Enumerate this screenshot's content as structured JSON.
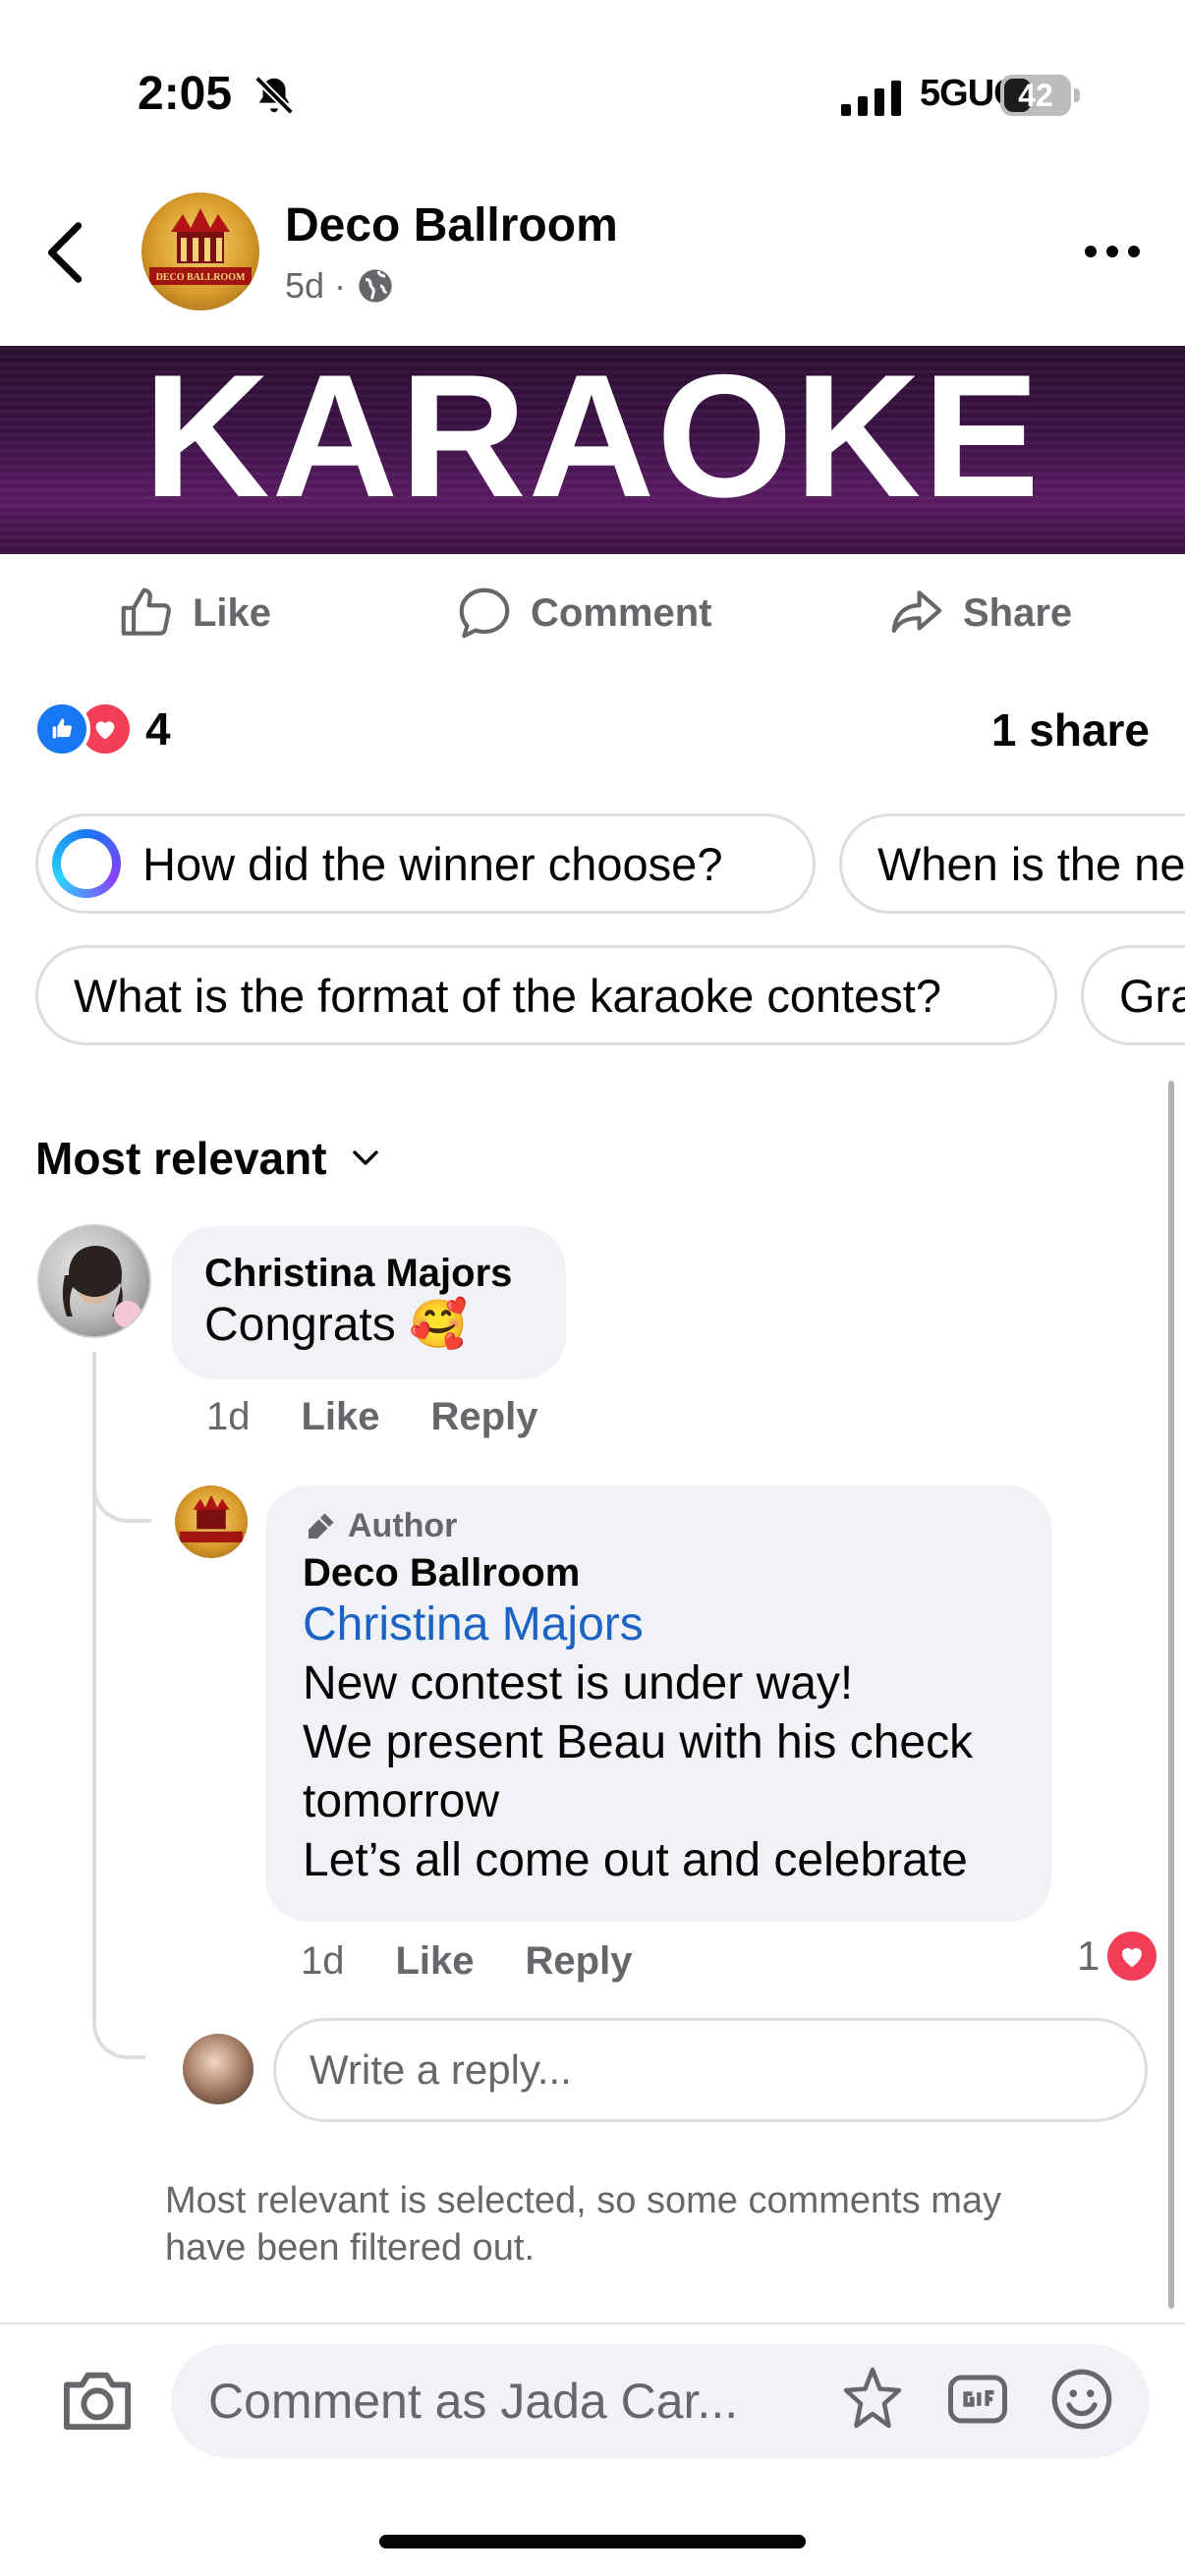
{
  "status_bar": {
    "time": "2:05",
    "network": "5GUC",
    "battery": "42",
    "battery_level_pct": 42
  },
  "header": {
    "page_name": "Deco Ballroom",
    "age": "5d",
    "separator": "·",
    "avatar_text": "DECO BALLROOM"
  },
  "banner": {
    "text": "KARAOKE"
  },
  "actions": {
    "like": "Like",
    "comment": "Comment",
    "share": "Share"
  },
  "stats": {
    "reaction_count": "4",
    "shares": "1 share"
  },
  "suggestions": [
    "How did the winner choose?",
    "When is the ne",
    "What is the format of the karaoke contest?",
    "Gra"
  ],
  "sort": {
    "label": "Most relevant"
  },
  "comments": [
    {
      "author": "Christina Majors",
      "text": "Congrats 🥰",
      "age": "1d",
      "like": "Like",
      "reply": "Reply",
      "replies": [
        {
          "badge": "Author",
          "author": "Deco Ballroom",
          "mention": "Christina Majors",
          "lines": [
            "New contest is under way!",
            "We present Beau with his check",
            "tomorrow",
            "Let’s all come out and celebrate"
          ],
          "age": "1d",
          "like": "Like",
          "reply": "Reply",
          "reaction_count": "1"
        }
      ]
    }
  ],
  "reply_input": {
    "placeholder": "Write a reply..."
  },
  "filter_note": "Most relevant is selected, so some comments may have been filtered out.",
  "composer": {
    "placeholder": "Comment as Jada Car..."
  },
  "colors": {
    "brand_blue": "#1877f2",
    "love_red": "#f33e58",
    "mention_blue": "#1b63c4",
    "muted": "#65676b"
  }
}
